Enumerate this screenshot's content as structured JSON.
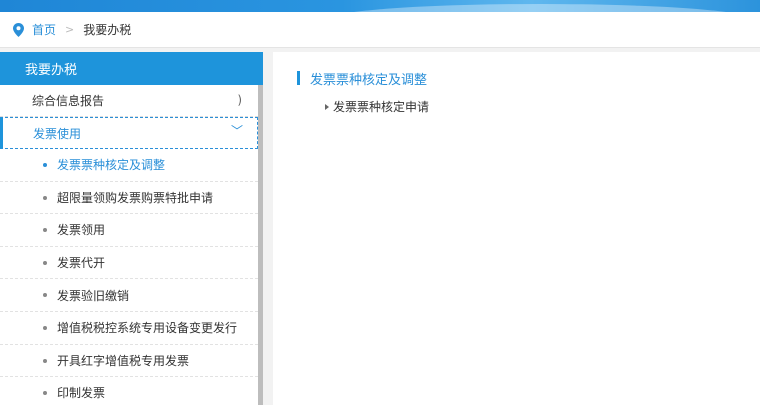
{
  "breadcrumb": {
    "home": "首页",
    "separator": ">",
    "current": "我要办税"
  },
  "sidebar": {
    "title": "我要办税",
    "items": [
      {
        "label": "综合信息报告",
        "arrow": ")"
      },
      {
        "label": "发票使用",
        "arrow": "﹀"
      }
    ],
    "subitems": [
      {
        "label": "发票票种核定及调整"
      },
      {
        "label": "超限量领购发票购票特批申请"
      },
      {
        "label": "发票领用"
      },
      {
        "label": "发票代开"
      },
      {
        "label": "发票验旧缴销"
      },
      {
        "label": "增值税税控系统专用设备变更发行"
      },
      {
        "label": "开具红字增值税专用发票"
      },
      {
        "label": "印制发票"
      }
    ]
  },
  "content": {
    "section_title": "发票票种核定及调整",
    "links": [
      {
        "label": "发票票种核定申请"
      }
    ]
  },
  "colors": {
    "accent": "#1e94db",
    "link": "#2a8fd8"
  }
}
